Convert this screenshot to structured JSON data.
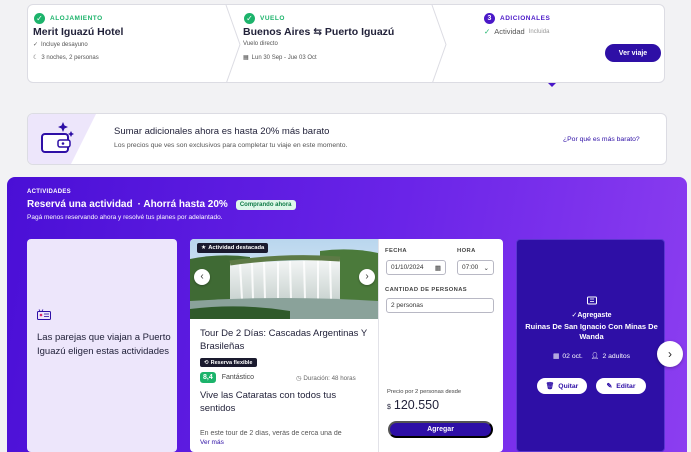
{
  "steps": {
    "hotel": {
      "label": "ALOJAMIENTO",
      "title": "Merit Iguazú Hotel",
      "detail1": "Incluye desayuno",
      "detail2": "3 noches, 2 personas"
    },
    "flight": {
      "label": "VUELO",
      "title": "Buenos Aires ⇆ Puerto Iguazú",
      "detail1": "Vuelo directo",
      "detail2": "Lun 30 Sep - Jue 03 Oct"
    },
    "extras": {
      "number": "3",
      "label": "ADICIONALES",
      "activity": "Actividad",
      "activity_status": "Incluida",
      "button": "Ver viaje"
    }
  },
  "banner": {
    "title": "Sumar adicionales ahora es hasta 20% más barato",
    "subtitle": "Los precios que ves son exclusivos para completar tu viaje en este momento.",
    "link": "¿Por qué es más barato?"
  },
  "activities": {
    "kicker": "ACTIVIDADES",
    "title": "Reservá una actividad",
    "savings": "· Ahorrá hasta 20%",
    "badge": "Comprando ahora",
    "subtitle": "Pagá menos reservando ahora y resolvé tus planes por adelantado.",
    "intro_text": "Las parejas que viajan a Puerto Iguazú eligen estas actividades",
    "card": {
      "badge": "Actividad destacada",
      "name": "Tour De 2 Días: Cascadas Argentinas Y Brasileñas",
      "flex_badge": "Reserva flexible",
      "score": "8,4",
      "score_word": "Fantástico",
      "duration": "Duración: 48 horas",
      "tagline": "Vive las Cataratas con todos tus sentidos",
      "description": "En este tour de 2 días, verás de cerca una de",
      "more": "Ver más",
      "date_label": "FECHA",
      "date_value": "01/10/2024",
      "time_label": "HORA",
      "time_value": "07:00",
      "people_label": "CANTIDAD DE PERSONAS",
      "people_value": "2 personas",
      "price_label": "Precio por 2 personas desde",
      "currency": "$",
      "price": "120.550",
      "add_button": "Agregar"
    },
    "added": {
      "label": "Agregaste",
      "name": "Ruinas De San Ignacio Con Minas De Wanda",
      "date": "02 oct.",
      "people": "2 adultos",
      "remove": "Quitar",
      "edit": "Editar"
    }
  },
  "colors": {
    "primary": "#2e0fa6",
    "success": "#1cb36b",
    "section_gradient_start": "#4a0fd6",
    "section_gradient_end": "#8c3ef0"
  }
}
